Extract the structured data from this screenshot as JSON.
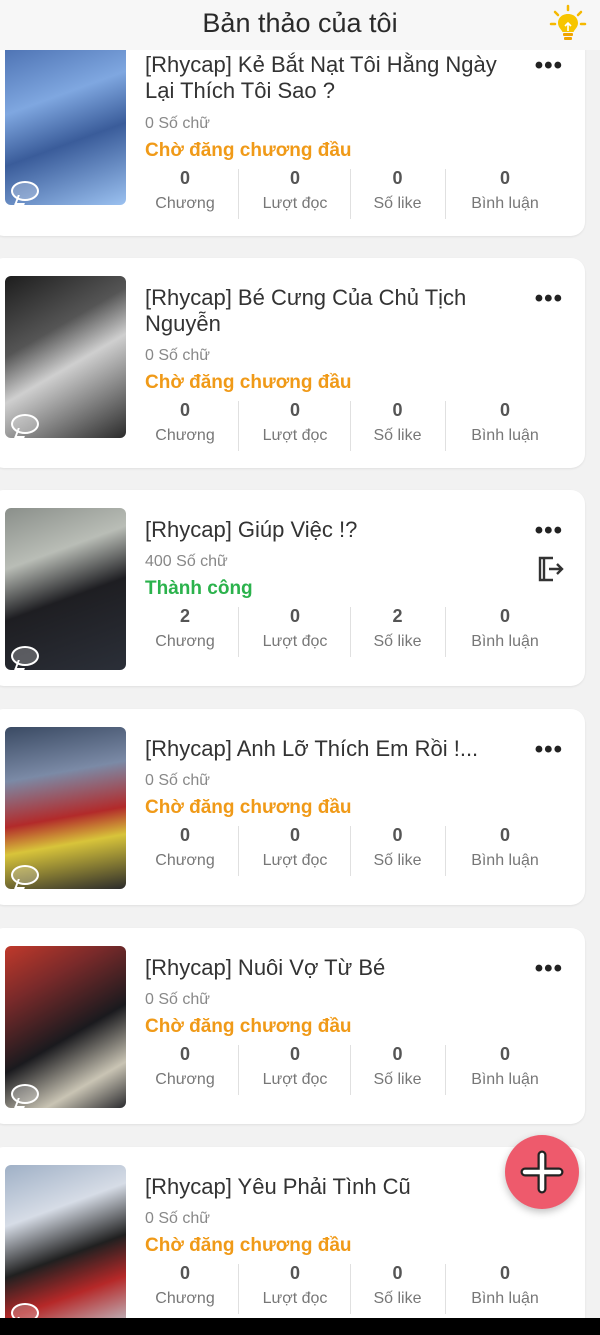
{
  "header": {
    "title": "Bản thảo của tôi",
    "back_glyph": "‹",
    "bulb_icon": "lightbulb-icon"
  },
  "stat_labels": {
    "chapters": "Chương",
    "reads": "Lượt đọc",
    "likes": "Số like",
    "comments": "Bình luận"
  },
  "stories": [
    {
      "title": "[Rhycap] Kẻ Bắt Nạt Tôi Hằng Ngày Lại Thích Tôi Sao ?",
      "words": "0 Số chữ",
      "status": "Chờ đăng chương đầu",
      "status_type": "pending",
      "chapters": "0",
      "reads": "0",
      "likes": "0",
      "comments": "0"
    },
    {
      "title": "[Rhycap] Bé Cưng Của Chủ Tịch Nguyễn",
      "words": "0 Số chữ",
      "status": "Chờ đăng chương đầu",
      "status_type": "pending",
      "chapters": "0",
      "reads": "0",
      "likes": "0",
      "comments": "0"
    },
    {
      "title": "[Rhycap] Giúp Việc !?",
      "words": "400 Số chữ",
      "status": "Thành công",
      "status_type": "ok",
      "chapters": "2",
      "reads": "0",
      "likes": "2",
      "comments": "0"
    },
    {
      "title": "[Rhycap] Anh Lỡ Thích Em Rồi !...",
      "words": "0 Số chữ",
      "status": "Chờ đăng chương đầu",
      "status_type": "pending",
      "chapters": "0",
      "reads": "0",
      "likes": "0",
      "comments": "0"
    },
    {
      "title": "[Rhycap] Nuôi Vợ Từ Bé",
      "words": "0 Số chữ",
      "status": "Chờ đăng chương đầu",
      "status_type": "pending",
      "chapters": "0",
      "reads": "0",
      "likes": "0",
      "comments": "0"
    },
    {
      "title": "[Rhycap] Yêu Phải Tình Cũ",
      "words": "0 Số chữ",
      "status": "Chờ đăng chương đầu",
      "status_type": "pending",
      "chapters": "0",
      "reads": "0",
      "likes": "0",
      "comments": "0"
    }
  ],
  "more_glyph": "•••",
  "colors": {
    "pending": "#f09a18",
    "ok": "#2bb24c",
    "fab": "#ee5a6c"
  },
  "fab": {
    "icon": "plus-icon"
  }
}
